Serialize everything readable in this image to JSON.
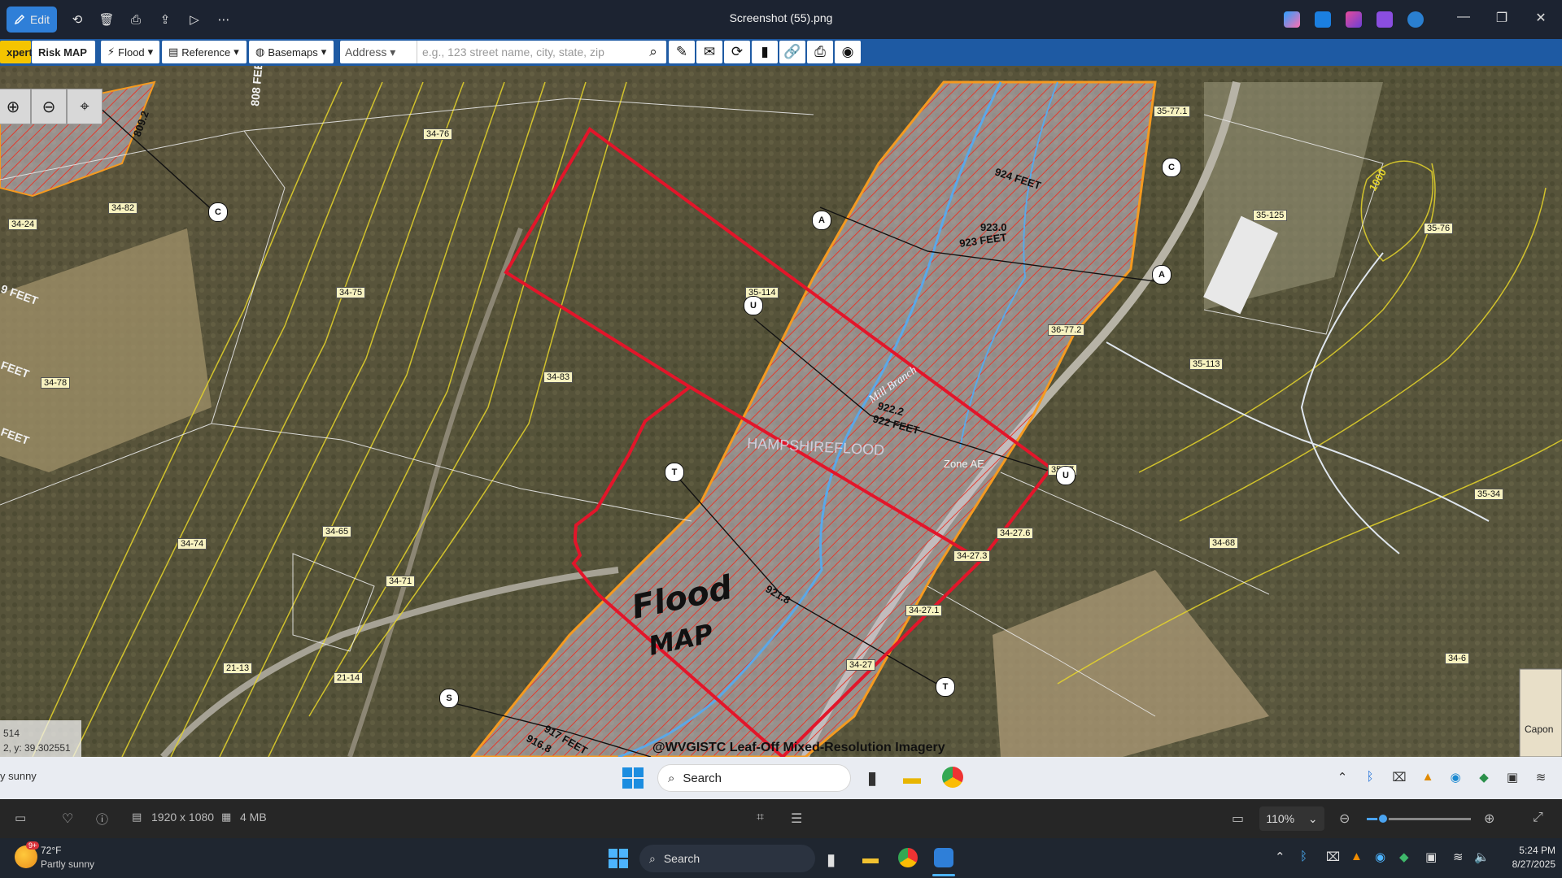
{
  "viewer": {
    "edit_label": "Edit",
    "window_title": "Screenshot (55).png",
    "icons": [
      "copilot-icon",
      "photos-icon",
      "designer-icon",
      "clipchamp-icon",
      "onedrive-icon"
    ]
  },
  "map_toolbar": {
    "expert_tab": "xpert",
    "risk_map_tab": "Risk MAP",
    "flood_menu": "Flood",
    "reference_menu": "Reference",
    "basemaps_menu": "Basemaps",
    "address_type": "Address",
    "address_placeholder": "e.g., 123 street name, city, state, zip"
  },
  "map": {
    "parcel_labels": [
      "34-76",
      "34-82",
      "34-24",
      "34-75",
      "34-78",
      "34-83",
      "34-74",
      "34-65",
      "34-71",
      "21-13",
      "21-14",
      "35-77.1",
      "35-125",
      "35-76",
      "35-114",
      "36-77.2",
      "35-113",
      "35-67",
      "35-34",
      "34-27.6",
      "34-68",
      "34-27.3",
      "34-27.1",
      "34-27",
      "34-6"
    ],
    "cross_sections": [
      "C",
      "A",
      "A",
      "U",
      "U",
      "T",
      "T",
      "S",
      "C"
    ],
    "elevation_labels": [
      "924 FEET",
      "923.0",
      "923 FEET",
      "922.2",
      "922 FEET",
      "921.8",
      "917 FEET",
      "916.8",
      "1000",
      "809.2"
    ],
    "stream_name": "Mill Branch",
    "overlay_text": "HAMPSHIREFLOOD",
    "zone_label": "Zone AE",
    "handwriting": [
      "Flood",
      "MAP"
    ],
    "imagery_credit": "@WVGISTC Leaf-Off Mixed-Resolution Imagery",
    "coord_line1": "514",
    "coord_line2": "2, y: 39.302551",
    "inset_label": "Capon",
    "left_labels": [
      "9 FEET",
      "FEET",
      "FEET",
      "808 FEET"
    ]
  },
  "inner_taskbar": {
    "weather": "y sunny",
    "search_label": "Search"
  },
  "viewer_footer": {
    "dimensions": "1920 x 1080",
    "file_size": "4 MB",
    "zoom_level": "110%"
  },
  "os_taskbar": {
    "temperature": "72°F",
    "condition": "Partly sunny",
    "weather_badge": "9+",
    "search_label": "Search",
    "time": "5:24 PM",
    "date": "8/27/2025"
  }
}
